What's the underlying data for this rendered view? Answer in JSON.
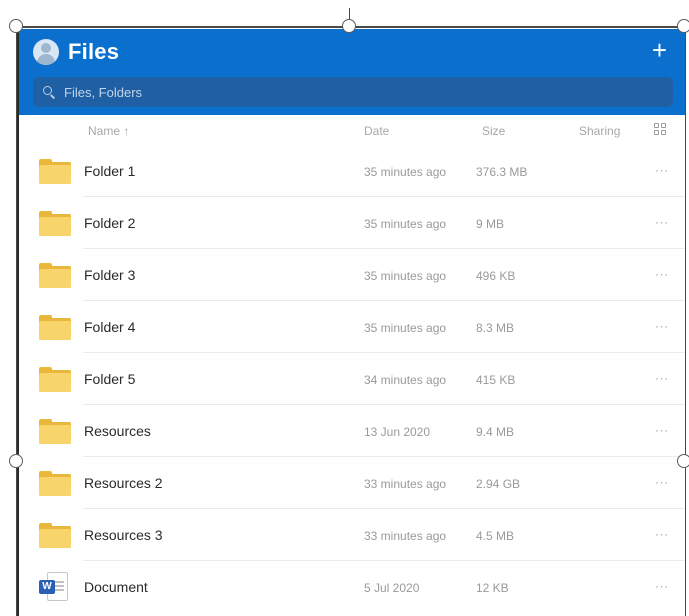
{
  "header": {
    "title": "Files",
    "add_icon": "+",
    "color": "#0b6fce"
  },
  "search": {
    "placeholder": "Files, Folders"
  },
  "columns": {
    "name": "Name ↑",
    "date": "Date",
    "size": "Size",
    "sharing": "Sharing"
  },
  "files": [
    {
      "name": "Folder 1",
      "date": "35 minutes ago",
      "size": "376.3 MB",
      "more": "···",
      "icon": "folder-icon"
    },
    {
      "name": "Folder 2",
      "date": "35 minutes ago",
      "size": "9 MB",
      "more": "···",
      "icon": "folder-icon"
    },
    {
      "name": "Folder 3",
      "date": "35 minutes ago",
      "size": "496 KB",
      "more": "···",
      "icon": "folder-icon"
    },
    {
      "name": "Folder 4",
      "date": "35 minutes ago",
      "size": "8.3 MB",
      "more": "···",
      "icon": "folder-icon"
    },
    {
      "name": "Folder 5",
      "date": "34 minutes ago",
      "size": "415 KB",
      "more": "···",
      "icon": "folder-icon"
    },
    {
      "name": "Resources",
      "date": "13 Jun 2020",
      "size": "9.4 MB",
      "more": "···",
      "icon": "folder-icon"
    },
    {
      "name": "Resources 2",
      "date": "33 minutes ago",
      "size": "2.94 GB",
      "more": "···",
      "icon": "folder-icon"
    },
    {
      "name": "Resources 3",
      "date": "33 minutes ago",
      "size": "4.5 MB",
      "more": "···",
      "icon": "folder-icon"
    },
    {
      "name": "Document",
      "date": "5 Jul 2020",
      "size": "12 KB",
      "more": "···",
      "icon": "word-document-icon",
      "badge": "W"
    }
  ]
}
